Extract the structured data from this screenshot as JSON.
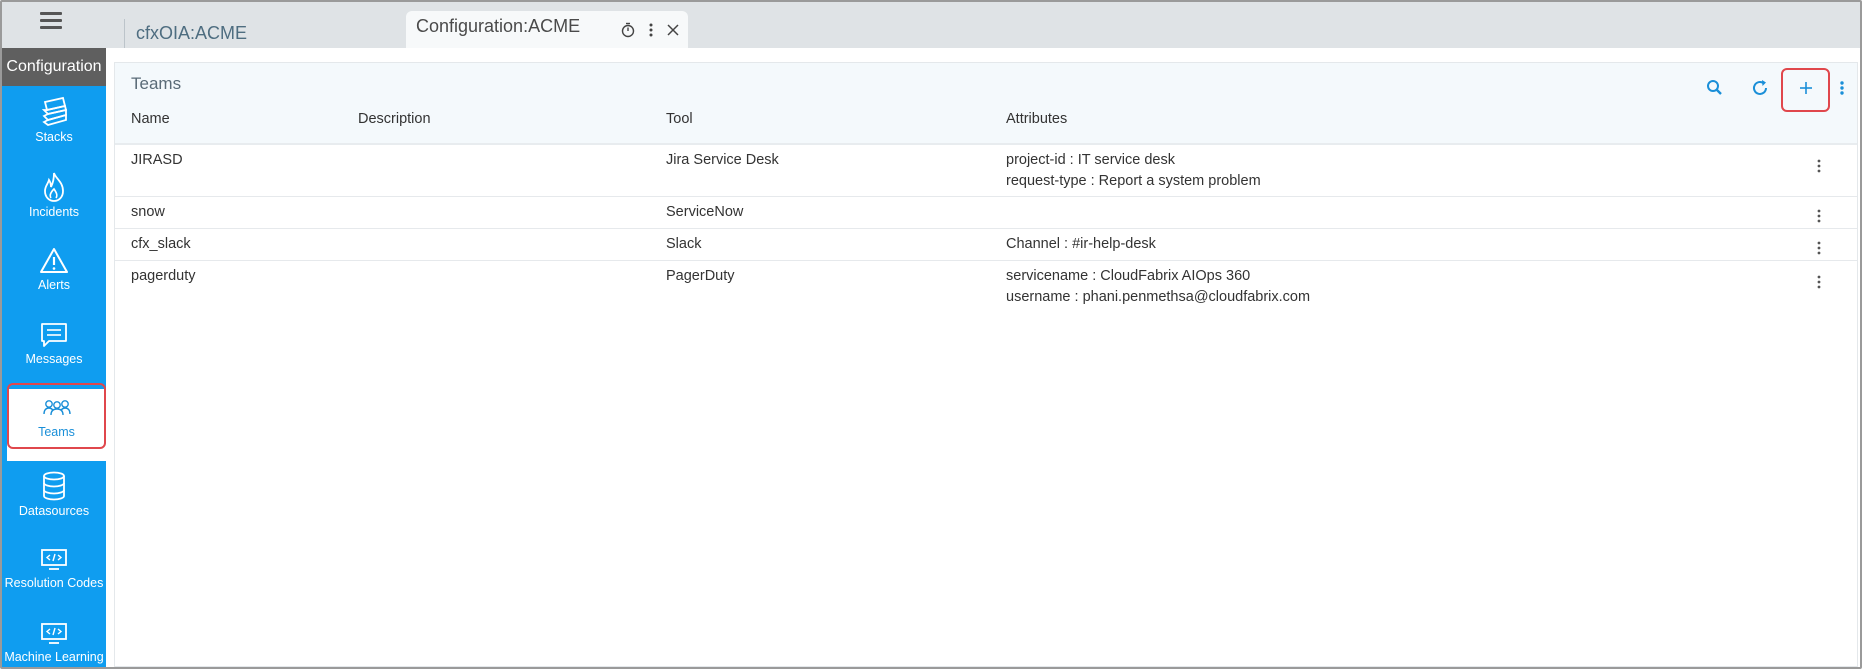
{
  "tabs": [
    {
      "label": "cfxOIA:ACME",
      "active": false
    },
    {
      "label": "Configuration:ACME",
      "active": true
    }
  ],
  "sidebar": {
    "header": "Configuration",
    "items": [
      {
        "label": "Stacks",
        "icon": "stacks-icon"
      },
      {
        "label": "Incidents",
        "icon": "fire-icon"
      },
      {
        "label": "Alerts",
        "icon": "warning-icon"
      },
      {
        "label": "Messages",
        "icon": "message-icon"
      },
      {
        "label": "Teams",
        "icon": "teams-icon",
        "selected": true
      },
      {
        "label": "Datasources",
        "icon": "database-icon"
      },
      {
        "label": "Resolution Codes",
        "icon": "code-monitor-icon"
      },
      {
        "label": "Machine Learning",
        "icon": "code-monitor-icon"
      }
    ]
  },
  "panel": {
    "title": "Teams",
    "columns": [
      "Name",
      "Description",
      "Tool",
      "Attributes"
    ],
    "rows": [
      {
        "name": "JIRASD",
        "description": "",
        "tool": "Jira Service Desk",
        "attributes": [
          "project-id : IT service desk",
          "request-type : Report a system problem"
        ]
      },
      {
        "name": "snow",
        "description": "",
        "tool": "ServiceNow",
        "attributes": []
      },
      {
        "name": "cfx_slack",
        "description": "",
        "tool": "Slack",
        "attributes": [
          "Channel : #ir-help-desk"
        ]
      },
      {
        "name": "pagerduty",
        "description": "",
        "tool": "PagerDuty",
        "attributes": [
          "servicename : CloudFabrix AIOps 360",
          "username : phani.penmethsa@cloudfabrix.com"
        ]
      }
    ]
  },
  "colors": {
    "sidebar": "#0f9df0",
    "accent": "#1a8fd8",
    "highlight": "#e0474c",
    "topbar": "#dfe3e6"
  }
}
